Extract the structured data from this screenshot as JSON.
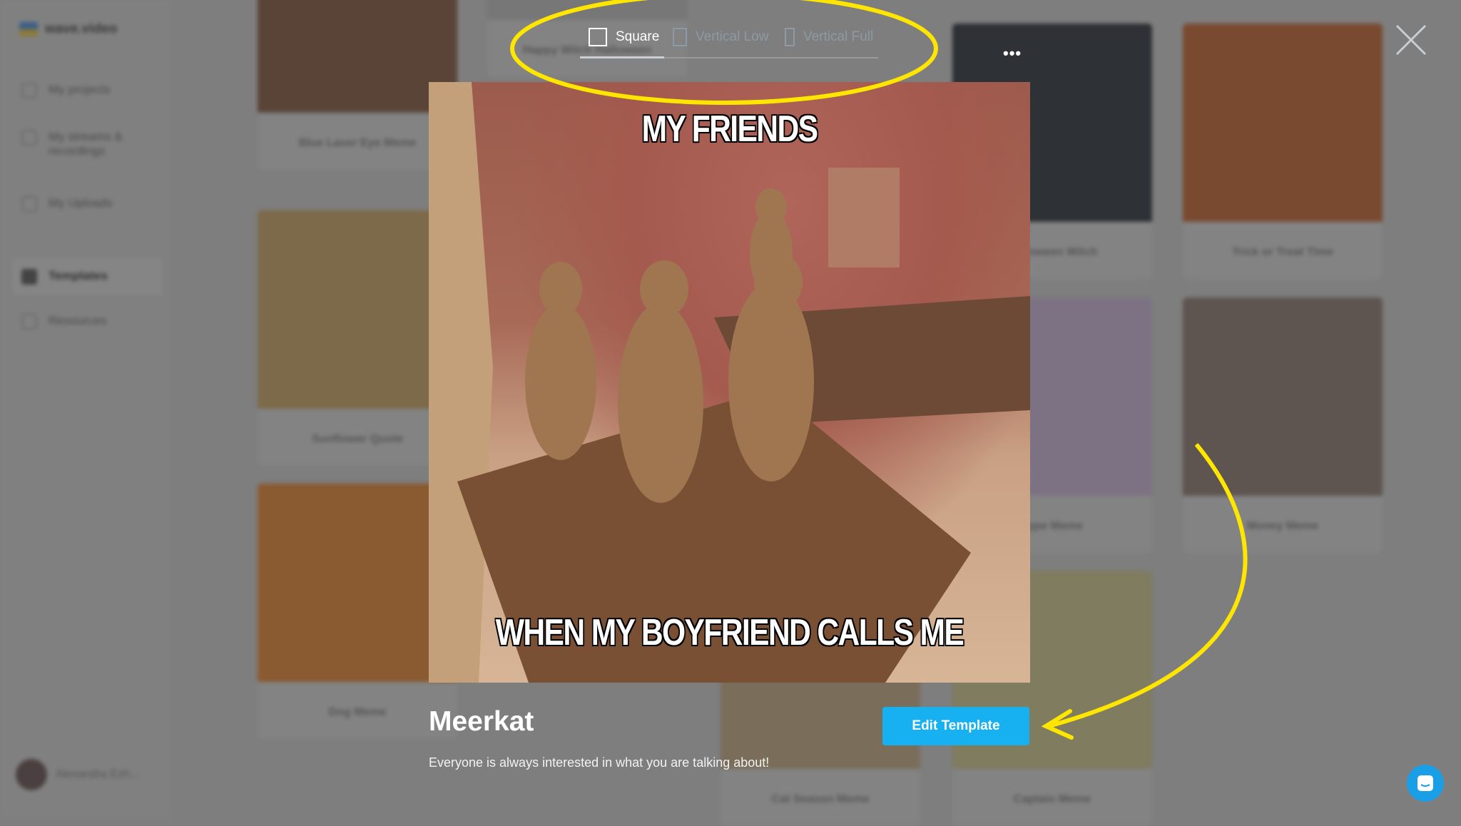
{
  "app": {
    "logo": "wave.video"
  },
  "sidebar": {
    "items": [
      {
        "label": "My projects"
      },
      {
        "label": "My streams & recordings"
      },
      {
        "label": "My Uploads"
      },
      {
        "label": "Templates",
        "active": true
      },
      {
        "label": "Resources"
      }
    ],
    "user": "Alexandra Ezh..."
  },
  "background_cards": [
    "Blue Laser Eye Meme",
    "Sunflower Quote",
    "Dog Meme",
    "Happy Witch Halloween",
    "Halloween Witch",
    "Trick or Treat Time",
    "Type Meme",
    "Money Meme",
    "Cat Season Meme",
    "Captain Meme"
  ],
  "modal": {
    "tabs": [
      {
        "label": "Square",
        "active": true
      },
      {
        "label": "Vertical Low"
      },
      {
        "label": "Vertical Full"
      }
    ],
    "more_label": "•••",
    "meme_top": "MY FRIENDS",
    "meme_bottom": "WHEN MY BOYFRIEND CALLS ME",
    "title": "Meerkat",
    "description": "Everyone is always interested in what you are talking about!",
    "edit_button": "Edit Template"
  },
  "colors": {
    "accent": "#17b1f1",
    "annotation": "#ffe600",
    "chat": "#1a9fe6"
  }
}
